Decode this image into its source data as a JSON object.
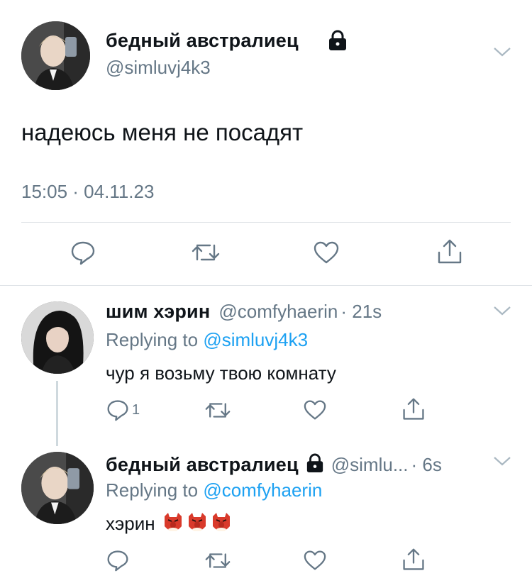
{
  "main_tweet": {
    "author_name": "бедный австралиец",
    "author_handle": "@simluvj4k3",
    "text": "надеюсь меня не посадят",
    "timestamp": "15:05 · 04.11.23",
    "avatar_icon": "user-photo-avatar",
    "lock_icon": "lock-icon",
    "actions": [
      "reply-icon",
      "retweet-icon",
      "like-icon",
      "share-icon"
    ]
  },
  "replies": [
    {
      "author_name": "шим хэрин",
      "author_handle": "@comfyhaerin",
      "time": "· 21s",
      "replying_label": "Replying to",
      "replying_to": "@simluvj4k3",
      "text": "чур я возьму твою комнату",
      "reply_count": "1"
    },
    {
      "author_name": "бедный австралиец",
      "author_handle": "@simlu...",
      "time": "· 6s",
      "replying_label": "Replying to",
      "replying_to": "@comfyhaerin",
      "text": "хэрин",
      "emoji": [
        "goblin-mask-emoji",
        "goblin-mask-emoji",
        "goblin-mask-emoji"
      ]
    }
  ],
  "colors": {
    "link": "#1da1f2",
    "secondary_text": "#657786",
    "divider": "#dfe3e7"
  }
}
